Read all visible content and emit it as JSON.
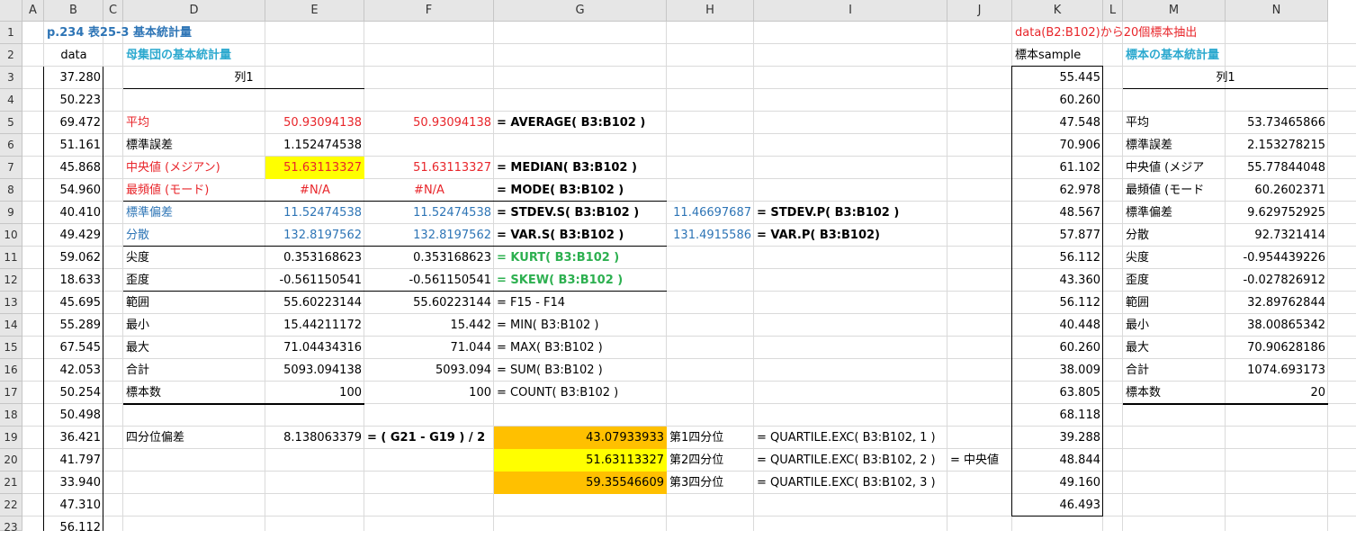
{
  "columns": [
    "A",
    "B",
    "C",
    "D",
    "E",
    "F",
    "G",
    "H",
    "I",
    "J",
    "K",
    "L",
    "M",
    "N"
  ],
  "rows": [
    "1",
    "2",
    "3",
    "4",
    "5",
    "6",
    "7",
    "8",
    "9",
    "10",
    "11",
    "12",
    "13",
    "14",
    "15",
    "16",
    "17",
    "18",
    "19",
    "20",
    "21",
    "22",
    "23"
  ],
  "title": "p.234 表25-3 基本統計量",
  "sample_note": "data(B2:B102)から20個標本抽出",
  "data_header": "data",
  "data": [
    "37.280",
    "50.223",
    "69.472",
    "51.161",
    "45.868",
    "54.960",
    "40.410",
    "49.429",
    "59.062",
    "18.633",
    "45.695",
    "55.289",
    "67.545",
    "42.053",
    "50.254",
    "50.498",
    "36.421",
    "41.797",
    "33.940",
    "47.310",
    "56.112"
  ],
  "pop_header": "母集団の基本統計量",
  "col1": "列1",
  "pop_stats": [
    {
      "label": "平均",
      "value": "50.93094138",
      "fvalue": "50.93094138",
      "formula": "= AVERAGE( B3:B102 )"
    },
    {
      "label": "標準誤差",
      "value": "1.152474538",
      "fvalue": "",
      "formula": ""
    },
    {
      "label": "中央値 (メジアン)",
      "value": "51.63113327",
      "fvalue": "51.63113327",
      "formula": "= MEDIAN( B3:B102 )"
    },
    {
      "label": "最頻値 (モード)",
      "value": "#N/A",
      "fvalue": "#N/A",
      "formula": "= MODE( B3:B102 )"
    },
    {
      "label": "標準偏差",
      "value": "11.52474538",
      "fvalue": "11.52474538",
      "formula": "= STDEV.S( B3:B102 )"
    },
    {
      "label": "分散",
      "value": "132.8197562",
      "fvalue": "132.8197562",
      "formula": "= VAR.S( B3:B102 )"
    },
    {
      "label": "尖度",
      "value": "0.353168623",
      "fvalue": "0.353168623",
      "formula": "= KURT( B3:B102 )"
    },
    {
      "label": "歪度",
      "value": "-0.561150541",
      "fvalue": "-0.561150541",
      "formula": "= SKEW( B3:B102 )"
    },
    {
      "label": "範囲",
      "value": "55.60223144",
      "fvalue": "55.60223144",
      "formula": "= F15 - F14"
    },
    {
      "label": "最小",
      "value": "15.44211172",
      "fvalue": "15.442",
      "formula": "= MIN( B3:B102 )"
    },
    {
      "label": "最大",
      "value": "71.04434316",
      "fvalue": "71.044",
      "formula": "= MAX( B3:B102 )"
    },
    {
      "label": "合計",
      "value": "5093.094138",
      "fvalue": "5093.094",
      "formula": "= SUM( B3:B102 )"
    },
    {
      "label": "標本数",
      "value": "100",
      "fvalue": "100",
      "formula": "= COUNT( B3:B102 )"
    }
  ],
  "stdevp": {
    "value": "11.46697687",
    "formula": "= STDEV.P( B3:B102 )"
  },
  "varp": {
    "value": "131.4915586",
    "formula": "= VAR.P( B3:B102)"
  },
  "quartile": {
    "label": "四分位偏差",
    "value": "8.138063379",
    "formula": "= ( G21 - G19 ) / 2",
    "q": [
      {
        "value": "43.07933933",
        "label": "第1四分位",
        "formula": "= QUARTILE.EXC( B3:B102, 1 )"
      },
      {
        "value": "51.63113327",
        "label": "第2四分位",
        "formula": "= QUARTILE.EXC( B3:B102, 2 )"
      },
      {
        "value": "59.35546609",
        "label": "第3四分位",
        "formula": "= QUARTILE.EXC( B3:B102, 3 )"
      }
    ],
    "median_note": "= 中央値"
  },
  "sample_header": "標本sample",
  "sample": [
    "55.445",
    "60.260",
    "47.548",
    "70.906",
    "61.102",
    "62.978",
    "48.567",
    "57.877",
    "56.112",
    "43.360",
    "56.112",
    "40.448",
    "60.260",
    "38.009",
    "63.805",
    "68.118",
    "39.288",
    "48.844",
    "49.160",
    "46.493"
  ],
  "sample_stats_header": "標本の基本統計量",
  "sample_stats": [
    {
      "label": "平均",
      "value": "53.73465866"
    },
    {
      "label": "標準誤差",
      "value": "2.153278215"
    },
    {
      "label": "中央値 (メジア",
      "value": "55.77844048"
    },
    {
      "label": "最頻値 (モード",
      "value": "60.2602371"
    },
    {
      "label": "標準偏差",
      "value": "9.629752925"
    },
    {
      "label": "分散",
      "value": "92.7321414"
    },
    {
      "label": "尖度",
      "value": "-0.954439226"
    },
    {
      "label": "歪度",
      "value": "-0.027826912"
    },
    {
      "label": "範囲",
      "value": "32.89762844"
    },
    {
      "label": "最小",
      "value": "38.00865342"
    },
    {
      "label": "最大",
      "value": "70.90628186"
    },
    {
      "label": "合計",
      "value": "1074.693173"
    },
    {
      "label": "標本数",
      "value": "20"
    }
  ],
  "colors": {
    "yellow": "#ffff00",
    "orange": "#ffc000",
    "red": "#e8262b",
    "blue": "#2e75b6",
    "green": "#2db050",
    "teal": "#2ca9cf"
  }
}
